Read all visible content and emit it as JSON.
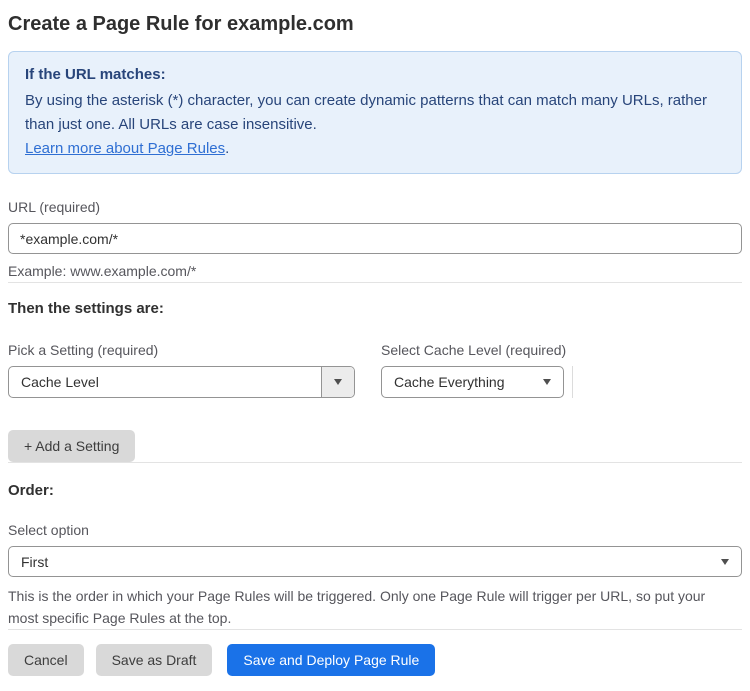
{
  "page": {
    "title": "Create a Page Rule for example.com"
  },
  "info_box": {
    "heading": "If the URL matches:",
    "body": "By using the asterisk (*) character, you can create dynamic patterns that can match many URLs, rather than just one. All URLs are case insensitive.",
    "link_label": "Learn more about Page Rules",
    "link_suffix": "."
  },
  "url_field": {
    "label": "URL (required)",
    "value": "*example.com/*",
    "helper": "Example: www.example.com/*"
  },
  "settings": {
    "heading": "Then the settings are:",
    "setting_select": {
      "label": "Pick a Setting (required)",
      "value": "Cache Level"
    },
    "cache_level_select": {
      "label": "Select Cache Level (required)",
      "value": "Cache Everything"
    },
    "add_setting_label": "+ Add a Setting"
  },
  "order": {
    "heading": "Order:",
    "label": "Select option",
    "value": "First",
    "helper": "This is the order in which your Page Rules will be triggered. Only one Page Rule will trigger per URL, so put your most specific Page Rules at the top."
  },
  "actions": {
    "cancel_label": "Cancel",
    "save_draft_label": "Save as Draft",
    "save_deploy_label": "Save and Deploy Page Rule"
  },
  "colors": {
    "accent_blue": "#1a72e8",
    "info_background": "#e8f1fb",
    "info_border": "#b7d2ef",
    "info_text": "#28457a",
    "link_blue": "#2f6fd3",
    "gray_button": "#d9d9d9"
  },
  "icons": {
    "dropdown_arrow": "caret-down-icon"
  }
}
